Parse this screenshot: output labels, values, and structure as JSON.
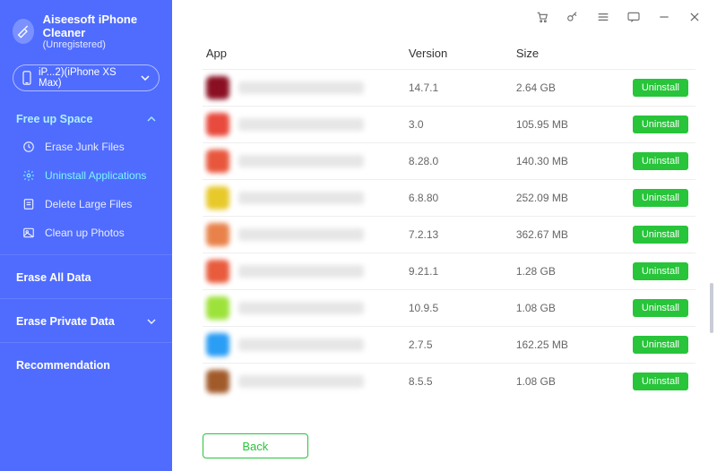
{
  "brand": {
    "title": "Aiseesoft iPhone Cleaner",
    "subtitle": "(Unregistered)"
  },
  "device": {
    "label": "iP...2)(iPhone XS Max)"
  },
  "sidebar": {
    "freeup_label": "Free up Space",
    "items": [
      {
        "label": "Erase Junk Files"
      },
      {
        "label": "Uninstall Applications"
      },
      {
        "label": "Delete Large Files"
      },
      {
        "label": "Clean up Photos"
      }
    ],
    "erase_all_label": "Erase All Data",
    "erase_private_label": "Erase Private Data",
    "recommendation_label": "Recommendation"
  },
  "table": {
    "headers": {
      "app": "App",
      "version": "Version",
      "size": "Size"
    },
    "uninstall_label": "Uninstall",
    "rows": [
      {
        "version": "14.7.1",
        "size": "2.64 GB",
        "color": "#8a0f22"
      },
      {
        "version": "3.0",
        "size": "105.95 MB",
        "color": "#e84a3d"
      },
      {
        "version": "8.28.0",
        "size": "140.30 MB",
        "color": "#e8573d"
      },
      {
        "version": "6.8.80",
        "size": "252.09 MB",
        "color": "#e8c92a"
      },
      {
        "version": "7.2.13",
        "size": "362.67 MB",
        "color": "#e8824a"
      },
      {
        "version": "9.21.1",
        "size": "1.28 GB",
        "color": "#e85b3d"
      },
      {
        "version": "10.9.5",
        "size": "1.08 GB",
        "color": "#9de23a"
      },
      {
        "version": "2.7.5",
        "size": "162.25 MB",
        "color": "#2a9df4"
      },
      {
        "version": "8.5.5",
        "size": "1.08 GB",
        "color": "#a15a2a"
      }
    ]
  },
  "footer": {
    "back_label": "Back"
  }
}
